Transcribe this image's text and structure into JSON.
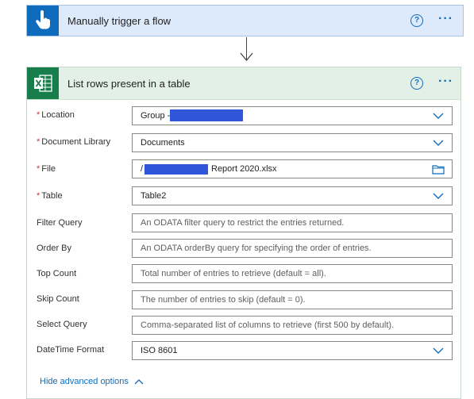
{
  "trigger": {
    "title": "Manually trigger a flow",
    "help": "?",
    "more": "···"
  },
  "action": {
    "title": "List rows present in a table",
    "help": "?",
    "more": "···",
    "fields": {
      "location": {
        "label": "Location",
        "value": "Group -"
      },
      "document_library": {
        "label": "Document Library",
        "value": "Documents"
      },
      "file": {
        "label": "File",
        "value_prefix": "/",
        "value_suffix": "Report 2020.xlsx"
      },
      "table": {
        "label": "Table",
        "value": "Table2"
      },
      "filter_query": {
        "label": "Filter Query",
        "placeholder": "An ODATA filter query to restrict the entries returned."
      },
      "order_by": {
        "label": "Order By",
        "placeholder": "An ODATA orderBy query for specifying the order of entries."
      },
      "top_count": {
        "label": "Top Count",
        "placeholder": "Total number of entries to retrieve (default = all)."
      },
      "skip_count": {
        "label": "Skip Count",
        "placeholder": "The number of entries to skip (default = 0)."
      },
      "select_query": {
        "label": "Select Query",
        "placeholder": "Comma-separated list of columns to retrieve (first 500 by default)."
      },
      "datetime_format": {
        "label": "DateTime Format",
        "value": "ISO 8601"
      }
    },
    "required_mark": "*",
    "advanced_link": "Hide advanced options"
  },
  "colors": {
    "accent": "#0f6cbd",
    "excel": "#177d4a",
    "redaction": "#2f56d8"
  },
  "icons": [
    "touch-hand-icon",
    "excel-icon",
    "help-icon",
    "more-icon",
    "chevron-down-icon",
    "folder-icon",
    "chevron-up-icon",
    "arrow-down-icon"
  ]
}
